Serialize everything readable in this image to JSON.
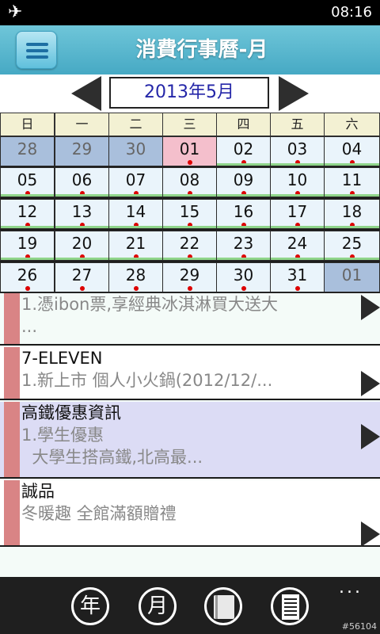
{
  "status_bar": {
    "airplane_icon": "✈",
    "time": "08:16"
  },
  "header": {
    "title": "消費行事曆-月",
    "menu_icon": "hamburger-menu-icon"
  },
  "month_nav": {
    "label": "2013年5月",
    "prev_icon": "left-triangle-icon",
    "next_icon": "right-triangle-icon"
  },
  "calendar": {
    "weekdays": [
      "日",
      "一",
      "二",
      "三",
      "四",
      "五",
      "六"
    ],
    "weeks": [
      [
        {
          "d": "28",
          "state": "other",
          "dot": false,
          "line": false
        },
        {
          "d": "29",
          "state": "other",
          "dot": false,
          "line": false
        },
        {
          "d": "30",
          "state": "other",
          "dot": false,
          "line": false
        },
        {
          "d": "01",
          "state": "today",
          "dot": true,
          "line": false
        },
        {
          "d": "02",
          "state": "normal",
          "dot": true,
          "line": true
        },
        {
          "d": "03",
          "state": "normal",
          "dot": true,
          "line": true
        },
        {
          "d": "04",
          "state": "normal",
          "dot": true,
          "line": true
        }
      ],
      [
        {
          "d": "05",
          "state": "normal",
          "dot": true,
          "line": true
        },
        {
          "d": "06",
          "state": "normal",
          "dot": true,
          "line": true
        },
        {
          "d": "07",
          "state": "normal",
          "dot": true,
          "line": true
        },
        {
          "d": "08",
          "state": "normal",
          "dot": true,
          "line": true
        },
        {
          "d": "09",
          "state": "normal",
          "dot": true,
          "line": true
        },
        {
          "d": "10",
          "state": "normal",
          "dot": true,
          "line": true
        },
        {
          "d": "11",
          "state": "normal",
          "dot": true,
          "line": true
        }
      ],
      [
        {
          "d": "12",
          "state": "normal",
          "dot": true,
          "line": true
        },
        {
          "d": "13",
          "state": "normal",
          "dot": true,
          "line": true
        },
        {
          "d": "14",
          "state": "normal",
          "dot": true,
          "line": true
        },
        {
          "d": "15",
          "state": "normal",
          "dot": true,
          "line": true
        },
        {
          "d": "16",
          "state": "normal",
          "dot": true,
          "line": true
        },
        {
          "d": "17",
          "state": "normal",
          "dot": true,
          "line": true
        },
        {
          "d": "18",
          "state": "normal",
          "dot": true,
          "line": true
        }
      ],
      [
        {
          "d": "19",
          "state": "normal",
          "dot": true,
          "line": true
        },
        {
          "d": "20",
          "state": "normal",
          "dot": true,
          "line": true
        },
        {
          "d": "21",
          "state": "normal",
          "dot": true,
          "line": true
        },
        {
          "d": "22",
          "state": "normal",
          "dot": true,
          "line": true
        },
        {
          "d": "23",
          "state": "normal",
          "dot": true,
          "line": true
        },
        {
          "d": "24",
          "state": "normal",
          "dot": true,
          "line": true
        },
        {
          "d": "25",
          "state": "normal",
          "dot": true,
          "line": true
        }
      ],
      [
        {
          "d": "26",
          "state": "normal",
          "dot": true,
          "line": false
        },
        {
          "d": "27",
          "state": "normal",
          "dot": true,
          "line": false
        },
        {
          "d": "28",
          "state": "normal",
          "dot": true,
          "line": false
        },
        {
          "d": "29",
          "state": "normal",
          "dot": true,
          "line": false
        },
        {
          "d": "30",
          "state": "normal",
          "dot": true,
          "line": false
        },
        {
          "d": "31",
          "state": "normal",
          "dot": true,
          "line": false
        },
        {
          "d": "01",
          "state": "other",
          "dot": false,
          "line": false
        }
      ]
    ]
  },
  "events": [
    {
      "title": "",
      "lines": [
        "1.憑ibon票,享經典冰淇淋買大送大",
        "..."
      ],
      "bg": "#f4fbf8"
    },
    {
      "title": "7-ELEVEN",
      "lines": [
        "1.新上市 個人小火鍋(2012/12/..."
      ],
      "bg": "#ffffff"
    },
    {
      "title": "高鐵優惠資訊",
      "lines": [
        "1.學生優惠",
        "  大學生搭高鐵,北高最..."
      ],
      "bg": "#dcdcf5"
    },
    {
      "title": "誠品",
      "lines": [
        "冬暖趣 全館滿額贈禮"
      ],
      "bg": "#ffffff"
    }
  ],
  "app_bar": {
    "year_label": "年",
    "month_label": "月",
    "book_icon": "book-icon",
    "list_icon": "notes-list-icon",
    "more": "..."
  },
  "watermark": "#56104",
  "colors": {
    "header": "#46a9c4",
    "today": "#f4bfcc",
    "other_month": "#a9bfdc",
    "event_dot": "#dd0000",
    "strip": "#d98485"
  }
}
